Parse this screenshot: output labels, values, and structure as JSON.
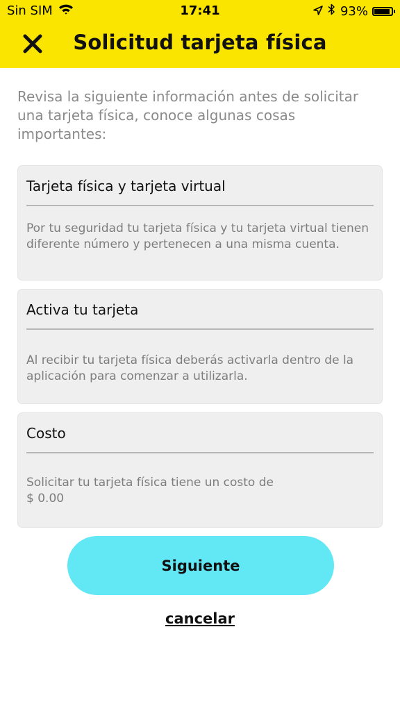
{
  "status_bar": {
    "carrier": "Sin SIM",
    "time": "17:41",
    "battery_percent": "93%",
    "battery_level": 0.93,
    "icons": [
      "wifi-icon",
      "location-arrow-icon",
      "bluetooth-icon",
      "battery-icon"
    ]
  },
  "header": {
    "title": "Solicitud tarjeta física",
    "close_icon": "close-icon",
    "background": "#f9e500"
  },
  "intro": "Revisa la siguiente información antes de solicitar una tarjeta física, conoce algunas cosas importantes:",
  "cards": [
    {
      "title": "Tarjeta física y tarjeta virtual",
      "body": "Por tu seguridad tu tarjeta física y tu tarjeta virtual tienen diferente número y  pertenecen a una misma cuenta."
    },
    {
      "title": "Activa tu tarjeta",
      "body": "Al recibir tu tarjeta física deberás activarla dentro de la aplicación para comenzar a utilizarla."
    },
    {
      "title": "Costo",
      "body_line1": "Solicitar tu tarjeta física tiene un costo de",
      "body_line2": "$ 0.00"
    }
  ],
  "actions": {
    "next_label": "Siguiente",
    "cancel_label": "cancelar",
    "next_color": "#62e7f5"
  }
}
